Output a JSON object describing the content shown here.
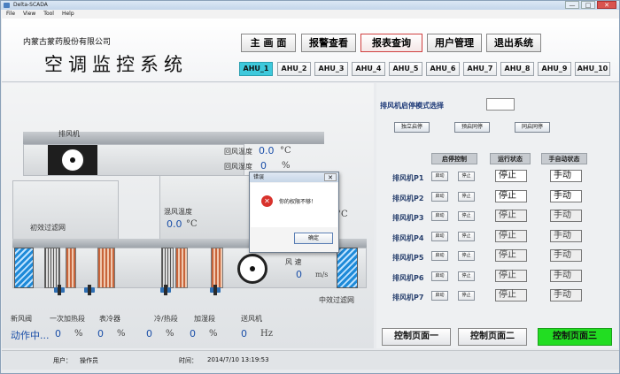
{
  "window": {
    "title": "Delta-SCADA",
    "controls": [
      "—",
      "□",
      "✕"
    ]
  },
  "menu": [
    "File",
    "View",
    "Tool",
    "Help"
  ],
  "header": {
    "company": "内蒙古蒙药股份有限公司",
    "title": "空调监控系统",
    "nav": [
      "主 画 面",
      "报警查看",
      "报表查询",
      "用户管理",
      "退出系统"
    ],
    "active_nav": 2,
    "ahu_tabs": [
      "AHU_1",
      "AHU_2",
      "AHU_3",
      "AHU_4",
      "AHU_5",
      "AHU_6",
      "AHU_7",
      "AHU_8",
      "AHU_9",
      "AHU_10"
    ],
    "active_ahu": 0
  },
  "schematic": {
    "exhaust_fan": "排风机",
    "return_temp_label": "回风温度",
    "return_temp_value": "0.0",
    "return_temp_unit": "°C",
    "return_humidity_label": "回风湿度",
    "return_humidity_value": "0",
    "return_humidity_unit": "%",
    "mix_temp_label": "混风温度",
    "mix_temp_value": "0.0",
    "mix_temp_unit": "°C",
    "primary_filter": "初效过滤网",
    "medium_filter": "中效过滤网",
    "wind_speed_label": "风 速",
    "wind_speed_value": "0",
    "wind_speed_unit": "m/s",
    "bottom_labels": [
      "新风阀",
      "一次加热段",
      "表冷器",
      "冷/热段",
      "加湿段",
      "送风机"
    ],
    "bottom_status": "动作中...",
    "bottom_values": [
      {
        "value": "0",
        "unit": "%"
      },
      {
        "value": "0",
        "unit": "%"
      },
      {
        "value": "0",
        "unit": "%"
      },
      {
        "value": "0",
        "unit": "%"
      },
      {
        "value": "0",
        "unit": "Hz"
      }
    ]
  },
  "panel": {
    "mode_title": "排风机启停模式选择",
    "mode_buttons": [
      "独立启停",
      "预启同停",
      "同启同停"
    ],
    "col_headers": [
      "启停控制",
      "运行状态",
      "手自动状态"
    ],
    "btn_start": "启动",
    "btn_stop": "停止",
    "fans": [
      {
        "name": "排风机P1",
        "state": "停止",
        "mode": "手动",
        "enabled": true
      },
      {
        "name": "排风机P2",
        "state": "停止",
        "mode": "手动",
        "enabled": true
      },
      {
        "name": "排风机P3",
        "state": "停止",
        "mode": "手动",
        "enabled": false
      },
      {
        "name": "排风机P4",
        "state": "停止",
        "mode": "手动",
        "enabled": false
      },
      {
        "name": "排风机P5",
        "state": "停止",
        "mode": "手动",
        "enabled": false
      },
      {
        "name": "排风机P6",
        "state": "停止",
        "mode": "手动",
        "enabled": false
      },
      {
        "name": "排风机P7",
        "state": "停止",
        "mode": "手动",
        "enabled": false
      }
    ],
    "pages": [
      "控制页面一",
      "控制页面二",
      "控制页面三"
    ],
    "active_page": 2
  },
  "dialog": {
    "title": "错误",
    "message": "你的权限不够！",
    "ok": "确定"
  },
  "status": {
    "user_label": "用户：",
    "user_value": "操作员",
    "time_label": "时间：",
    "time_value": "2014/7/10 13:19:53"
  },
  "colors": {
    "accent_ahu": "#3ec9dc",
    "active_page": "#22dd22",
    "value_blue": "#1b4fa8",
    "error_red": "#d8322c"
  }
}
